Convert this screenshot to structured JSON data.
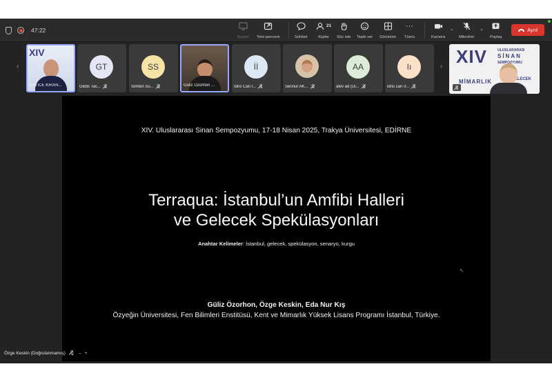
{
  "toolbar": {
    "timer": "47:22",
    "buttons": {
      "start": "Başlat",
      "new_window": "Yeni pencere",
      "chat": "Sohbet",
      "people": "Kişiler",
      "people_count": "21",
      "raise": "Söz iste",
      "react": "Tepki ver",
      "view": "Görünüm",
      "more": "Tümü",
      "camera": "Kamera",
      "mic": "Mikrofon",
      "share": "Paylaş",
      "leave": "Ayrıl"
    }
  },
  "gallery": {
    "tiles": [
      {
        "name": "HATİCE KIRAN...",
        "initials": ""
      },
      {
        "name": "Gildis Tac...",
        "initials": "GT",
        "color": "#e4e6f5"
      },
      {
        "name": "Simten Su...",
        "initials": "SS",
        "color": "#f6e3a6"
      },
      {
        "name": "Güliz Özorhon ...",
        "initials": ""
      },
      {
        "name": "İdris Can I...",
        "initials": "İİ",
        "color": "#dde8f5"
      },
      {
        "name": "Sennur AK...",
        "initials": ""
      },
      {
        "name": "alev ad (Di...",
        "initials": "AA",
        "color": "#dcecd8"
      },
      {
        "name": "idris can ır...",
        "initials": "Iı",
        "color": "#fbe1c8"
      }
    ],
    "poster_big": "XIV",
    "poster_lines": [
      "ULUSLARARASI",
      "SİNAN",
      "SEMPOZYUMU"
    ],
    "poster_bottom": [
      "MİMARLIK",
      "GELECEK"
    ]
  },
  "slide": {
    "conference": "XIV. Uluslararası Sinan Sempozyumu, 17-18 Nisan 2025, Trakya Üniversitesi, EDİRNE",
    "title_line1": "Terraqua: İstanbul’un Amfibi Halleri",
    "title_line2": "ve Gelecek Spekülasyonları",
    "keywords_label": "Anahtar Kelimeler",
    "keywords": ": İstanbul, gelecek, spekülasyon, senaryo, kurgu",
    "authors": "Güliz Özorhon, Özge Keskin, Eda Nur Kış",
    "affiliation": "Özyeğin Üniversitesi, Fen Bilimleri Enstitüsü, Kent ve Mimarlık Yüksek Lisans Programı İstanbul, Türkiye."
  },
  "speaker": {
    "name": "Özge Keskin (Doğrulanmamış)"
  },
  "colors": {
    "leave": "#d9352c",
    "active_border": "#9aa6ff",
    "background": "#232323"
  }
}
